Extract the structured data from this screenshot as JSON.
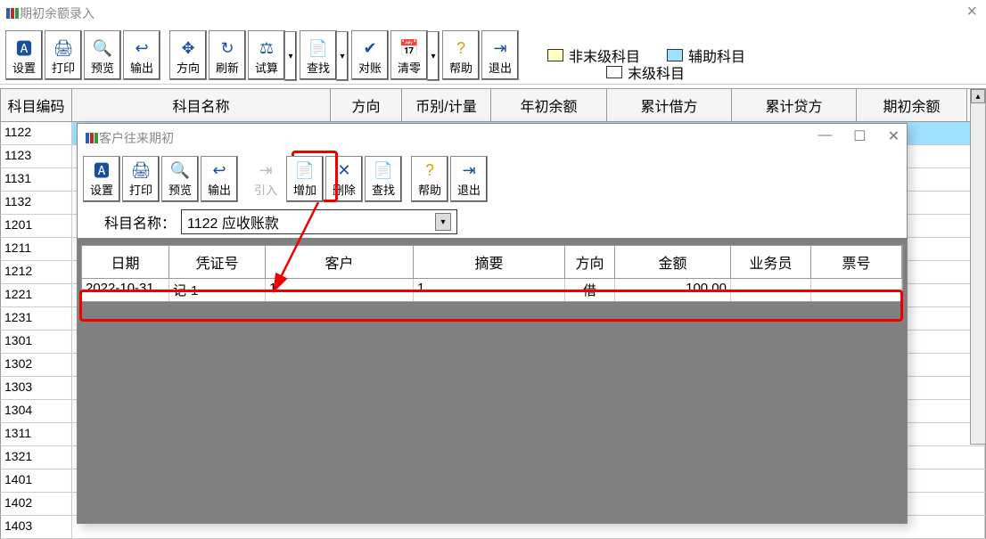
{
  "main_window": {
    "title": "期初余额录入",
    "toolbar": [
      {
        "id": "settings",
        "label": "设置"
      },
      {
        "id": "print",
        "label": "打印"
      },
      {
        "id": "preview",
        "label": "预览"
      },
      {
        "id": "export",
        "label": "输出"
      },
      {
        "id": "direction",
        "label": "方向"
      },
      {
        "id": "refresh",
        "label": "刷新"
      },
      {
        "id": "trial",
        "label": "试算"
      },
      {
        "id": "find",
        "label": "查找"
      },
      {
        "id": "reconcile",
        "label": "对账"
      },
      {
        "id": "clear",
        "label": "清零"
      },
      {
        "id": "help",
        "label": "帮助"
      },
      {
        "id": "exit",
        "label": "退出"
      }
    ],
    "legend": {
      "non_leaf": "非末级科目",
      "aux": "辅助科目",
      "leaf": "末级科目"
    },
    "columns": {
      "code": "科目编码",
      "name": "科目名称",
      "dir": "方向",
      "curr": "币别/计量",
      "yearopen": "年初余额",
      "cum_dr": "累计借方",
      "cum_cr": "累计贷方",
      "open": "期初余额"
    },
    "rows": [
      "1122",
      "1123",
      "1131",
      "1132",
      "1201",
      "1211",
      "1212",
      "1221",
      "1231",
      "1301",
      "1302",
      "1303",
      "1304",
      "1311",
      "1321",
      "1401",
      "1402",
      "1403"
    ]
  },
  "sub_window": {
    "title": "客户往来期初",
    "toolbar": [
      {
        "id": "settings",
        "label": "设置"
      },
      {
        "id": "print",
        "label": "打印"
      },
      {
        "id": "preview",
        "label": "预览"
      },
      {
        "id": "export",
        "label": "输出"
      },
      {
        "id": "import",
        "label": "引入",
        "disabled": true
      },
      {
        "id": "add",
        "label": "增加"
      },
      {
        "id": "delete",
        "label": "删除"
      },
      {
        "id": "find",
        "label": "查找"
      },
      {
        "id": "help",
        "label": "帮助"
      },
      {
        "id": "exit",
        "label": "退出"
      }
    ],
    "subject_label": "科目名称：",
    "subject_value": "1122 应收账款",
    "columns": {
      "date": "日期",
      "voucher": "凭证号",
      "customer": "客户",
      "summary": "摘要",
      "dir": "方向",
      "amount": "金额",
      "staff": "业务员",
      "bill": "票号"
    },
    "row": {
      "date": "2022-10-31",
      "voucher": "记-1",
      "customer": "1",
      "summary": "1",
      "dir": "借",
      "amount": "100.00",
      "staff": "",
      "bill": ""
    }
  }
}
